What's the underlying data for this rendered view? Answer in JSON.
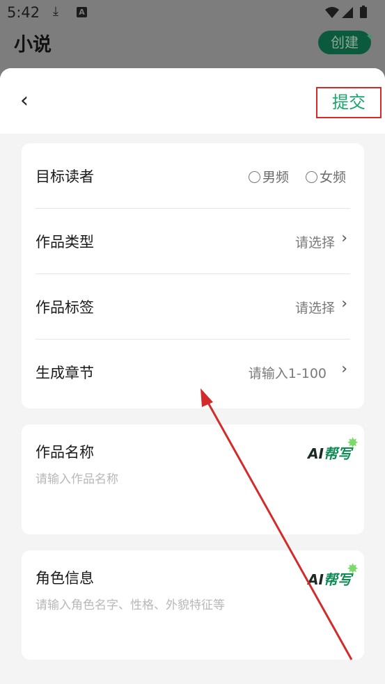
{
  "status_bar": {
    "time": "5:42",
    "download_icon": "download-icon",
    "notification_badge": "A"
  },
  "background_app": {
    "title": "小说",
    "create_label": "创建"
  },
  "sheet": {
    "submit_label": "提交",
    "rows": [
      {
        "label": "目标读者",
        "options": [
          "男频",
          "女频"
        ]
      },
      {
        "label": "作品类型",
        "value": "请选择"
      },
      {
        "label": "作品标签",
        "value": "请选择"
      },
      {
        "label": "生成章节",
        "value": "请输入1-100"
      }
    ],
    "name_card": {
      "title": "作品名称",
      "placeholder": "请输入作品名称",
      "ai_label": "帮写",
      "ai_prefix": "AI"
    },
    "role_card": {
      "title": "角色信息",
      "placeholder": "请输入角色名字、性格、外貌特征等",
      "ai_label": "帮写",
      "ai_prefix": "AI"
    }
  },
  "colors": {
    "accent_green": "#17a66a",
    "highlight_red": "#d42a2a"
  }
}
